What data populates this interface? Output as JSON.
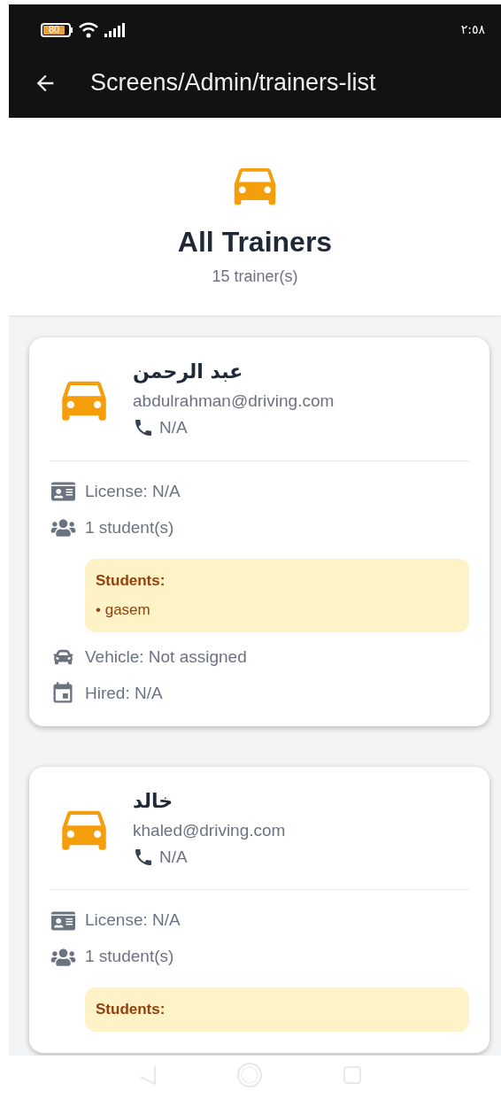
{
  "status_bar": {
    "battery": "80",
    "time": "٢:٥٨"
  },
  "app_bar": {
    "title": "Screens/Admin/trainers-list"
  },
  "header": {
    "title": "All Trainers",
    "count": "15 trainer(s)"
  },
  "trainers": [
    {
      "name": "عبد الرحمن",
      "email": "abdulrahman@driving.com",
      "phone": "N/A",
      "license": "License: N/A",
      "students_count": "1 student(s)",
      "students": {
        "heading": "Students:",
        "items": [
          "• gasem"
        ]
      },
      "vehicle": "Vehicle: Not assigned",
      "hired": "Hired: N/A"
    },
    {
      "name": "خالد",
      "email": "khaled@driving.com",
      "phone": "N/A",
      "license": "License: N/A",
      "students_count": "1 student(s)",
      "students": {
        "heading": "Students:"
      }
    }
  ]
}
